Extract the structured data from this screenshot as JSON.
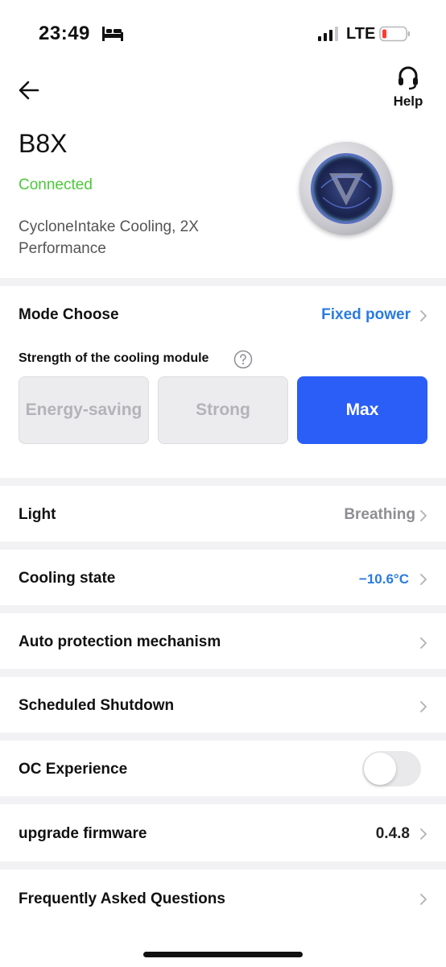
{
  "status_bar": {
    "time": "23:49",
    "network": "LTE",
    "icons": [
      "bed-icon",
      "signal-icon",
      "battery-icon"
    ]
  },
  "header": {
    "back_icon": "arrow-left-icon",
    "help_label": "Help",
    "help_icon": "headset-icon"
  },
  "device": {
    "name": "B8X",
    "status": "Connected",
    "description": "CycloneIntake Cooling, 2X Performance"
  },
  "mode": {
    "title": "Mode Choose",
    "value": "Fixed power",
    "strength_label": "Strength of the cooling module",
    "options": [
      "Energy-saving",
      "Strong",
      "Max"
    ],
    "selected": "Max"
  },
  "settings": {
    "light": {
      "label": "Light",
      "value": "Breathing"
    },
    "cooling_state": {
      "label": "Cooling state",
      "value": "−10.6°C"
    },
    "auto_protection": {
      "label": "Auto protection mechanism"
    },
    "scheduled_shutdown": {
      "label": "Scheduled Shutdown"
    },
    "oc_experience": {
      "label": "OC Experience",
      "enabled": false
    },
    "upgrade_firmware": {
      "label": "upgrade firmware",
      "value": "0.4.8"
    },
    "faq": {
      "label": "Frequently Asked Questions"
    }
  },
  "colors": {
    "accent_blue": "#2a5ef7",
    "link_blue": "#2a7be0",
    "connected_green": "#4cc93a",
    "muted_text": "#8e8e93",
    "section_gap": "#f2f2f4"
  }
}
